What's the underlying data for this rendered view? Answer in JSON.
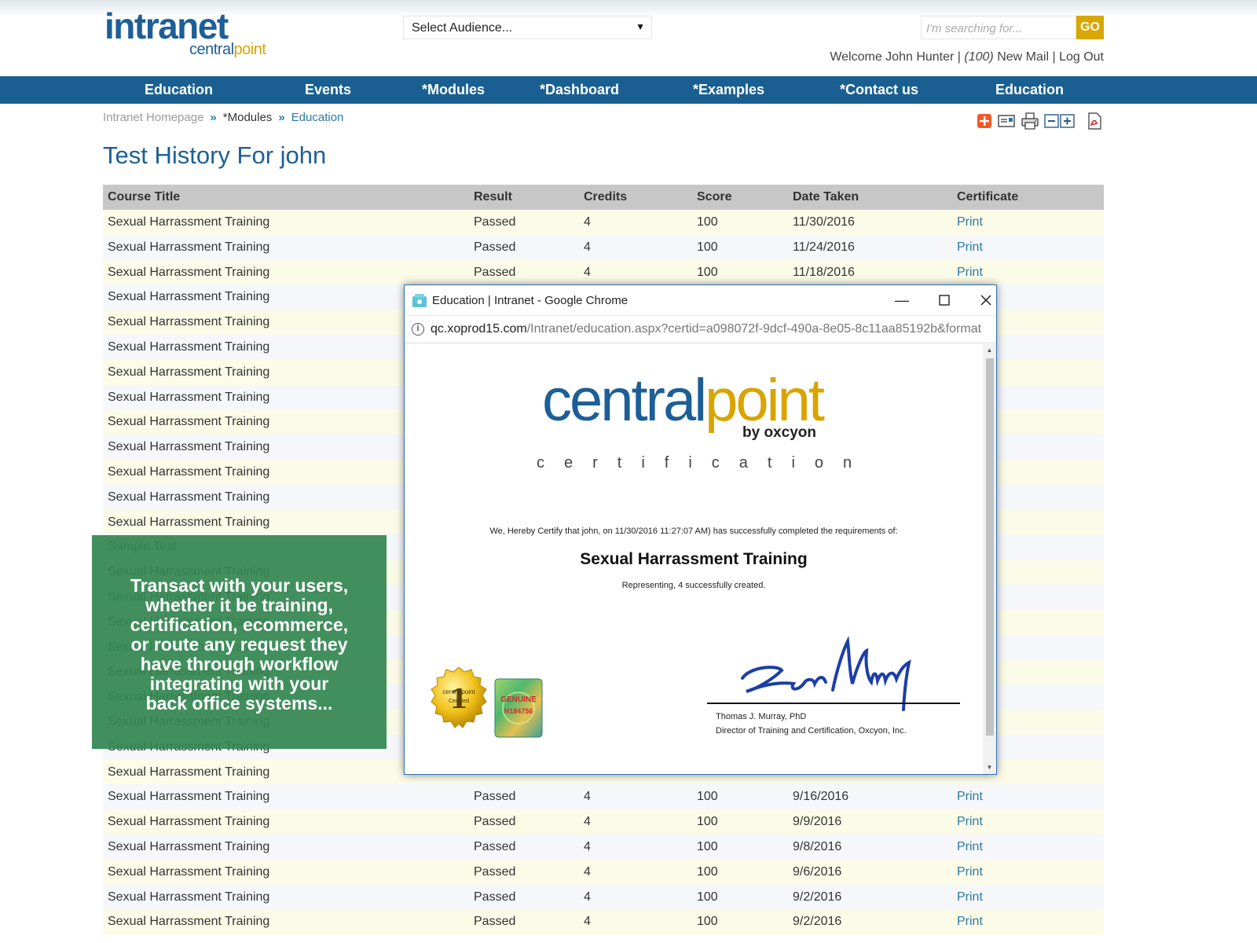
{
  "logo": {
    "main": "intranet",
    "sub_part1": "central",
    "sub_part2": "point"
  },
  "header": {
    "audience_placeholder": "Select Audience...",
    "search_placeholder": "I'm searching for...",
    "search_button": "GO",
    "welcome_text": "Welcome John Hunter |",
    "mail_count": "(100)",
    "mail_label": "New Mail |",
    "logout": "Log Out"
  },
  "nav": [
    {
      "label": "Education"
    },
    {
      "label": "Events"
    },
    {
      "label": "*Modules"
    },
    {
      "label": "*Dashboard"
    },
    {
      "label": "*Examples"
    },
    {
      "label": "*Contact us"
    },
    {
      "label": "Education"
    }
  ],
  "breadcrumb": {
    "home": "Intranet Homepage",
    "sep": "»",
    "modules": "*Modules",
    "current": "Education"
  },
  "page_title": "Test History For john",
  "table": {
    "headers": {
      "title": "Course Title",
      "result": "Result",
      "credits": "Credits",
      "score": "Score",
      "date": "Date Taken",
      "certificate": "Certificate"
    },
    "rows": [
      {
        "title": "Sexual Harrassment Training",
        "result": "Passed",
        "credits": "4",
        "score": "100",
        "date": "11/30/2016",
        "cert": "Print"
      },
      {
        "title": "Sexual Harrassment Training",
        "result": "Passed",
        "credits": "4",
        "score": "100",
        "date": "11/24/2016",
        "cert": "Print"
      },
      {
        "title": "Sexual Harrassment Training",
        "result": "Passed",
        "credits": "4",
        "score": "100",
        "date": "11/18/2016",
        "cert": "Print"
      },
      {
        "title": "Sexual Harrassment Training",
        "result": "",
        "credits": "",
        "score": "",
        "date": "",
        "cert": ""
      },
      {
        "title": "Sexual Harrassment Training",
        "result": "",
        "credits": "",
        "score": "",
        "date": "",
        "cert": ""
      },
      {
        "title": "Sexual Harrassment Training",
        "result": "",
        "credits": "",
        "score": "",
        "date": "",
        "cert": ""
      },
      {
        "title": "Sexual Harrassment Training",
        "result": "",
        "credits": "",
        "score": "",
        "date": "",
        "cert": ""
      },
      {
        "title": "Sexual Harrassment Training",
        "result": "",
        "credits": "",
        "score": "",
        "date": "",
        "cert": ""
      },
      {
        "title": "Sexual Harrassment Training",
        "result": "",
        "credits": "",
        "score": "",
        "date": "",
        "cert": ""
      },
      {
        "title": "Sexual Harrassment Training",
        "result": "",
        "credits": "",
        "score": "",
        "date": "",
        "cert": ""
      },
      {
        "title": "Sexual Harrassment Training",
        "result": "",
        "credits": "",
        "score": "",
        "date": "",
        "cert": ""
      },
      {
        "title": "Sexual Harrassment Training",
        "result": "",
        "credits": "",
        "score": "",
        "date": "",
        "cert": ""
      },
      {
        "title": "Sexual Harrassment Training",
        "result": "",
        "credits": "",
        "score": "",
        "date": "",
        "cert": ""
      },
      {
        "title": "Sample Test",
        "result": "",
        "credits": "",
        "score": "",
        "date": "",
        "cert": ""
      },
      {
        "title": "Sexual Harrassment Training",
        "result": "",
        "credits": "",
        "score": "",
        "date": "",
        "cert": ""
      },
      {
        "title": "Sexual Harrassment Training",
        "result": "",
        "credits": "",
        "score": "",
        "date": "",
        "cert": ""
      },
      {
        "title": "Sexual Harrassment Training",
        "result": "",
        "credits": "",
        "score": "",
        "date": "",
        "cert": ""
      },
      {
        "title": "Sexual Harrassment Training",
        "result": "",
        "credits": "",
        "score": "",
        "date": "",
        "cert": ""
      },
      {
        "title": "Sexual Harrassment Training",
        "result": "",
        "credits": "",
        "score": "",
        "date": "",
        "cert": ""
      },
      {
        "title": "Sexual Harrassment Training",
        "result": "",
        "credits": "",
        "score": "",
        "date": "",
        "cert": ""
      },
      {
        "title": "Sexual Harrassment Training",
        "result": "",
        "credits": "",
        "score": "",
        "date": "",
        "cert": ""
      },
      {
        "title": "Sexual Harrassment Training",
        "result": "",
        "credits": "",
        "score": "",
        "date": "",
        "cert": ""
      },
      {
        "title": "Sexual Harrassment Training",
        "result": "",
        "credits": "",
        "score": "",
        "date": "",
        "cert": ""
      },
      {
        "title": "Sexual Harrassment Training",
        "result": "Passed",
        "credits": "4",
        "score": "100",
        "date": "9/16/2016",
        "cert": "Print"
      },
      {
        "title": "Sexual Harrassment Training",
        "result": "Passed",
        "credits": "4",
        "score": "100",
        "date": "9/9/2016",
        "cert": "Print"
      },
      {
        "title": "Sexual Harrassment Training",
        "result": "Passed",
        "credits": "4",
        "score": "100",
        "date": "9/8/2016",
        "cert": "Print"
      },
      {
        "title": "Sexual Harrassment Training",
        "result": "Passed",
        "credits": "4",
        "score": "100",
        "date": "9/6/2016",
        "cert": "Print"
      },
      {
        "title": "Sexual Harrassment Training",
        "result": "Passed",
        "credits": "4",
        "score": "100",
        "date": "9/2/2016",
        "cert": "Print"
      },
      {
        "title": "Sexual Harrassment Training",
        "result": "Passed",
        "credits": "4",
        "score": "100",
        "date": "9/2/2016",
        "cert": "Print"
      }
    ]
  },
  "promo": {
    "lines": [
      "Transact with your users,",
      "whether it be training,",
      "certification, ecommerce,",
      "or route any request they",
      "have through workflow",
      "integrating with your",
      "back office systems..."
    ]
  },
  "popup": {
    "window_title": "Education | Intranet - Google Chrome",
    "url_domain": "qc.xoprod15.com",
    "url_path": "/Intranet/education.aspx?certid=a098072f-9dcf-490a-8e05-8c11aa85192b&format",
    "cert": {
      "brand_part1": "central",
      "brand_part2": "point",
      "byline": "by oxcyon",
      "certification_word": "certification",
      "statement": "We, Hereby Certify that  john, on  11/30/2016 11:27:07 AM)  has successfully completed the requirements of:",
      "course": "Sexual Harrassment Training",
      "representing": "Representing,  4 successfully created.",
      "seal_text_1": "centralpoint",
      "seal_text_2": "Certified",
      "seal_number": "1",
      "holo_text_1": "GENUINE",
      "holo_text_2": "H184756",
      "signer_name": "Thomas J. Murray, PhD",
      "signer_title": "Director of Training and Certification, Oxcyon, Inc."
    }
  },
  "colors": {
    "brand_blue": "#1c5f98",
    "brand_gold": "#d9a400",
    "nav_bg": "#1a5f91",
    "promo_green": "#348752",
    "link": "#2b7aa4"
  }
}
